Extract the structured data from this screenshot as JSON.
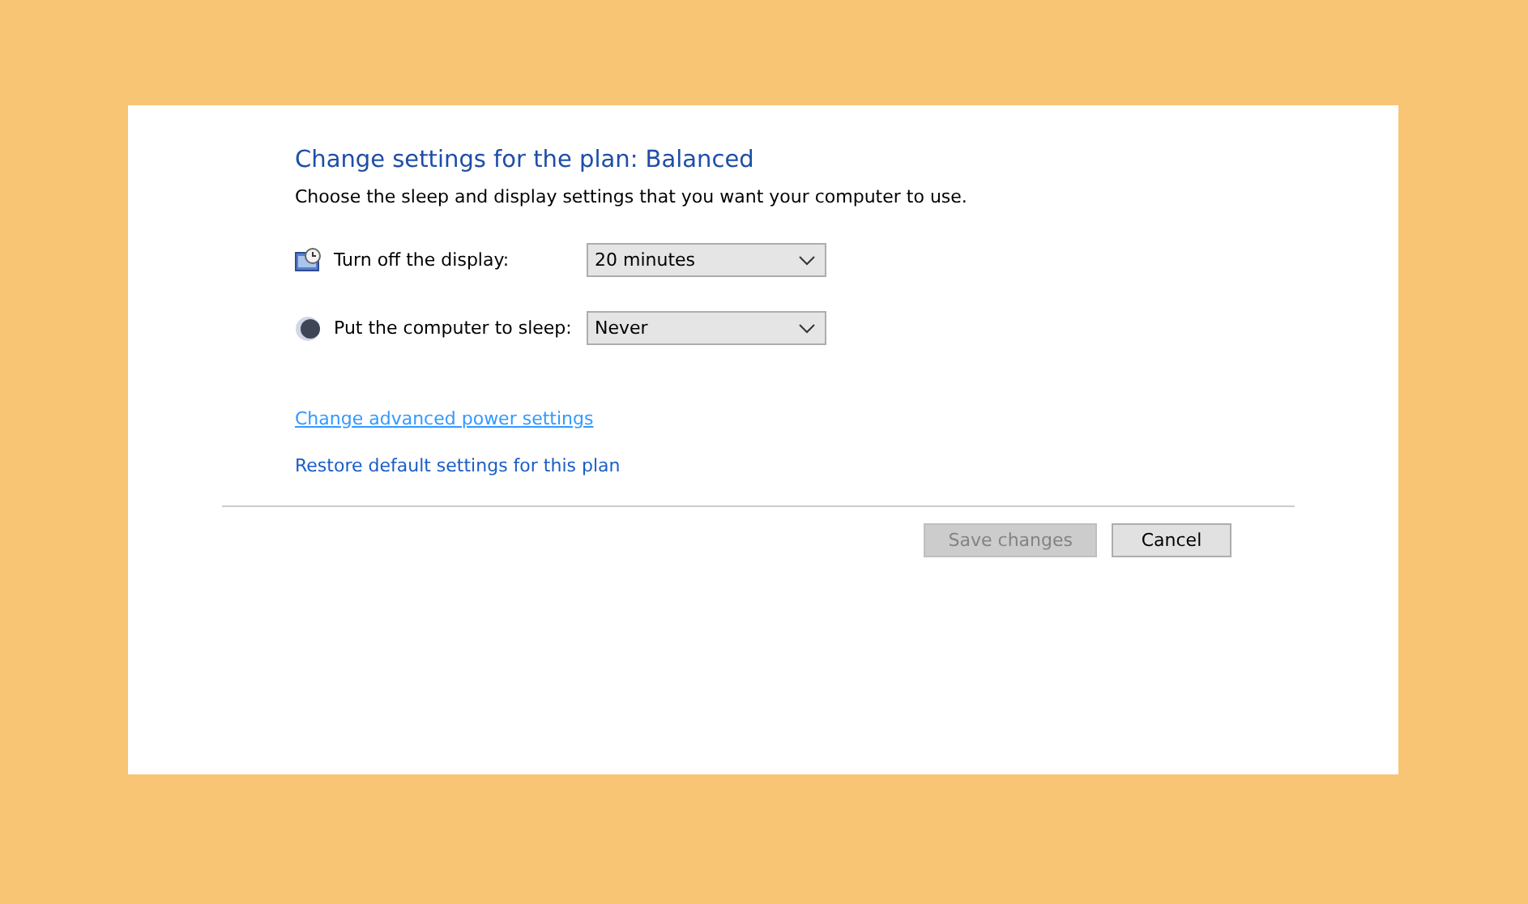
{
  "heading": "Change settings for the plan: Balanced",
  "description": "Choose the sleep and display settings that you want your computer to use.",
  "settings": [
    {
      "kind": "display",
      "label": "Turn off the display:",
      "value": "20 minutes"
    },
    {
      "kind": "sleep",
      "label": "Put the computer to sleep:",
      "value": "Never"
    }
  ],
  "links": [
    {
      "label": "Change advanced power settings",
      "hovered": true
    },
    {
      "label": "Restore default settings for this plan",
      "hovered": false
    }
  ],
  "buttons": [
    {
      "label": "Save changes",
      "disabled": true
    },
    {
      "label": "Cancel",
      "disabled": false
    }
  ]
}
